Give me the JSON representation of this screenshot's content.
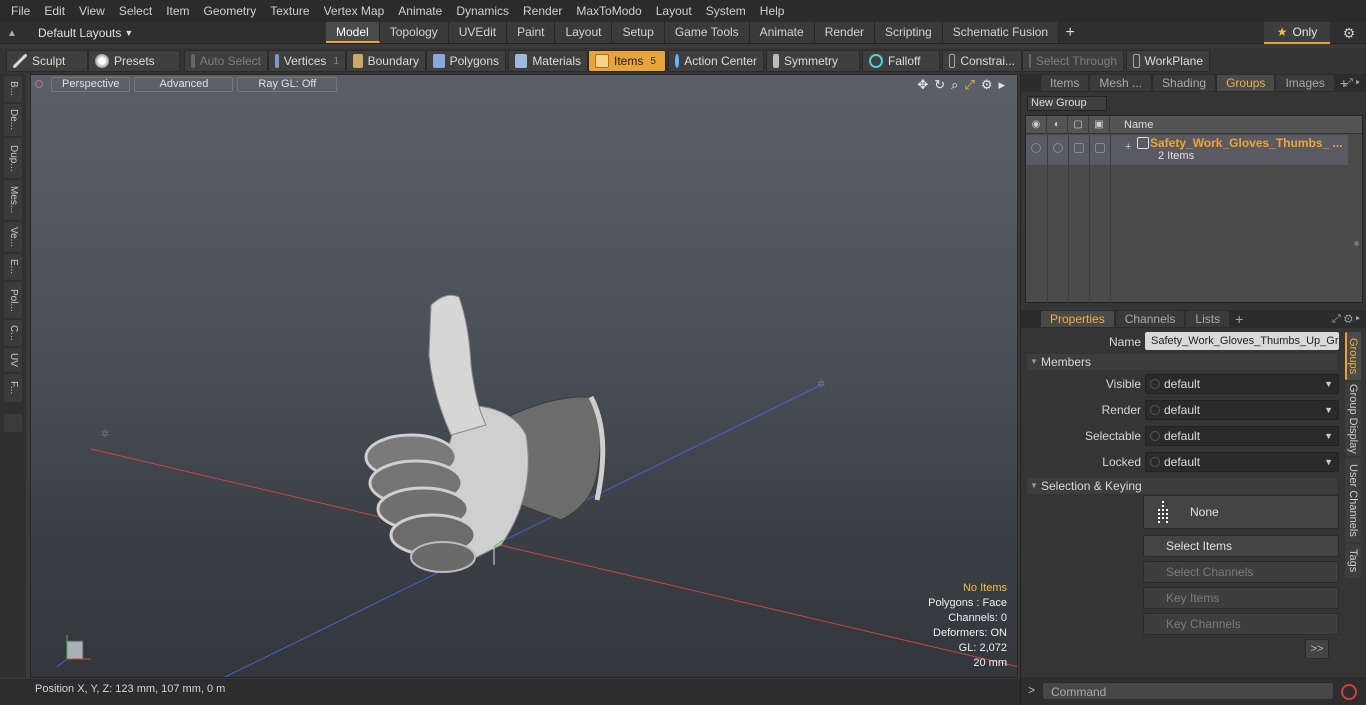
{
  "menu": [
    "File",
    "Edit",
    "View",
    "Select",
    "Item",
    "Geometry",
    "Texture",
    "Vertex Map",
    "Animate",
    "Dynamics",
    "Render",
    "MaxToModo",
    "Layout",
    "System",
    "Help"
  ],
  "layouts": {
    "label": "Default Layouts"
  },
  "mode_tabs": [
    "Model",
    "Topology",
    "UVEdit",
    "Paint",
    "Layout",
    "Setup",
    "Game Tools",
    "Animate",
    "Render",
    "Scripting",
    "Schematic Fusion"
  ],
  "active_tab": "Model",
  "only_label": "Only",
  "toolbar": {
    "sculpt": "Sculpt",
    "presets": "Presets",
    "auto_select": "Auto Select",
    "vertices": "Vertices",
    "vertices_count": "1",
    "boundary": "Boundary",
    "polygons": "Polygons",
    "materials": "Materials",
    "items": "Items",
    "items_count": "5",
    "action_center": "Action Center",
    "symmetry": "Symmetry",
    "falloff": "Falloff",
    "constraints": "Constrai...",
    "select_through": "Select Through",
    "workplane": "WorkPlane"
  },
  "left_tabs": [
    "B...",
    "De...",
    "Dup...",
    "Mes...",
    "Ve...",
    "E...",
    "Pol...",
    "C...",
    "UV",
    "F..."
  ],
  "viewport": {
    "perspective": "Perspective",
    "advanced": "Advanced",
    "raygl": "Ray GL: Off",
    "info": {
      "selection": "No Items",
      "polygons": "Polygons : Face",
      "channels": "Channels: 0",
      "deformers": "Deformers: ON",
      "gl": "GL: 2,072",
      "scale": "20 mm"
    }
  },
  "status": {
    "position": "Position X, Y, Z:   123 mm, 107 mm, 0 m"
  },
  "groups_panel": {
    "tabs": [
      "Items",
      "Mesh ...",
      "Shading",
      "Groups",
      "Images"
    ],
    "active": "Groups",
    "new_group": "New Group",
    "col_name": "Name",
    "group": {
      "name": "Safety_Work_Gloves_Thumbs_ ...",
      "count": "2 Items"
    }
  },
  "props_panel": {
    "tabs": [
      "Properties",
      "Channels",
      "Lists"
    ],
    "active": "Properties",
    "name_label": "Name",
    "name_value": "Safety_Work_Gloves_Thumbs_Up_Gr",
    "members": "Members",
    "visible_label": "Visible",
    "visible": "default",
    "render_label": "Render",
    "render": "default",
    "selectable_label": "Selectable",
    "selectable": "default",
    "locked_label": "Locked",
    "locked": "default",
    "sel_keying": "Selection & Keying",
    "none": "None",
    "select_items": "Select Items",
    "select_channels": "Select Channels",
    "key_items": "Key Items",
    "key_channels": "Key Channels",
    "more": ">>",
    "side_tabs": [
      "Groups",
      "Group Display",
      "User Channels",
      "Tags"
    ]
  },
  "command": {
    "placeholder": "Command",
    "prompt": ">"
  }
}
